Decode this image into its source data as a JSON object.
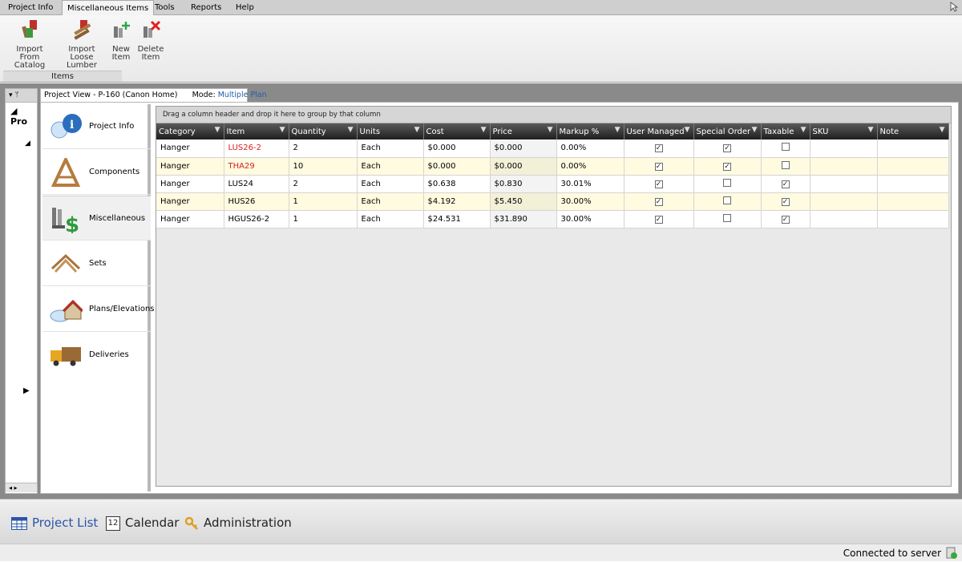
{
  "menu": {
    "tabs": [
      "Project Info",
      "Miscellaneous Items",
      "Tools",
      "Reports",
      "Help"
    ],
    "active_index": 1
  },
  "ribbon": {
    "buttons": [
      {
        "label1": "Import",
        "label2": "From Catalog",
        "icon": "import-catalog-icon"
      },
      {
        "label1": "Import",
        "label2": "Loose Lumber",
        "icon": "import-lumber-icon"
      },
      {
        "label1": "New",
        "label2": "Item",
        "icon": "new-item-icon"
      },
      {
        "label1": "Delete",
        "label2": "Item",
        "icon": "delete-item-icon"
      }
    ],
    "group_label": "Items"
  },
  "left_nav": {
    "header_label": "Pro"
  },
  "project_view": {
    "title": "Project View - P-160 (Canon Home)",
    "mode_label": "Mode:",
    "mode_value": "Multiple Plan"
  },
  "categories": [
    {
      "label": "Project Info",
      "icon": "project-info-icon"
    },
    {
      "label": "Components",
      "icon": "components-icon"
    },
    {
      "label": "Miscellaneous",
      "icon": "miscellaneous-icon",
      "selected": true
    },
    {
      "label": "Sets",
      "icon": "sets-icon"
    },
    {
      "label": "Plans/Elevations",
      "icon": "plans-elevations-icon"
    },
    {
      "label": "Deliveries",
      "icon": "deliveries-icon"
    }
  ],
  "grid": {
    "group_hint": "Drag a column header and drop it here to group by that column",
    "columns": [
      "Category",
      "Item",
      "Quantity",
      "Units",
      "Cost",
      "Price",
      "Markup %",
      "User Managed",
      "Special Order",
      "Taxable",
      "SKU",
      "Note"
    ],
    "rows": [
      {
        "category": "Hanger",
        "item": "LUS26-2",
        "item_red": true,
        "quantity": "2",
        "units": "Each",
        "cost": "$0.000",
        "price": "$0.000",
        "markup": "0.00%",
        "user_managed": true,
        "special_order": true,
        "taxable": false,
        "sku": "",
        "note": ""
      },
      {
        "category": "Hanger",
        "item": "THA29",
        "item_red": true,
        "quantity": "10",
        "units": "Each",
        "cost": "$0.000",
        "price": "$0.000",
        "markup": "0.00%",
        "user_managed": true,
        "special_order": true,
        "taxable": false,
        "sku": "",
        "note": ""
      },
      {
        "category": "Hanger",
        "item": "LUS24",
        "item_red": false,
        "quantity": "2",
        "units": "Each",
        "cost": "$0.638",
        "price": "$0.830",
        "markup": "30.01%",
        "user_managed": true,
        "special_order": false,
        "taxable": true,
        "sku": "",
        "note": ""
      },
      {
        "category": "Hanger",
        "item": "HUS26",
        "item_red": false,
        "quantity": "1",
        "units": "Each",
        "cost": "$4.192",
        "price": "$5.450",
        "markup": "30.00%",
        "user_managed": true,
        "special_order": false,
        "taxable": true,
        "sku": "",
        "note": ""
      },
      {
        "category": "Hanger",
        "item": "HGUS26-2",
        "item_red": false,
        "quantity": "1",
        "units": "Each",
        "cost": "$24.531",
        "price": "$31.890",
        "markup": "30.00%",
        "user_managed": true,
        "special_order": false,
        "taxable": true,
        "sku": "",
        "note": ""
      }
    ]
  },
  "bottom_nav": [
    {
      "label": "Project List",
      "icon": "table-icon",
      "selected": true
    },
    {
      "label": "Calendar",
      "icon": "calendar-icon",
      "day": "12"
    },
    {
      "label": "Administration",
      "icon": "keys-icon"
    }
  ],
  "status": {
    "text": "Connected to server"
  },
  "colors": {
    "accent": "#2a54a8",
    "red_item": "#d81f1f",
    "alt_row": "#fffbe0",
    "grid_header": "#1e1e1e"
  }
}
